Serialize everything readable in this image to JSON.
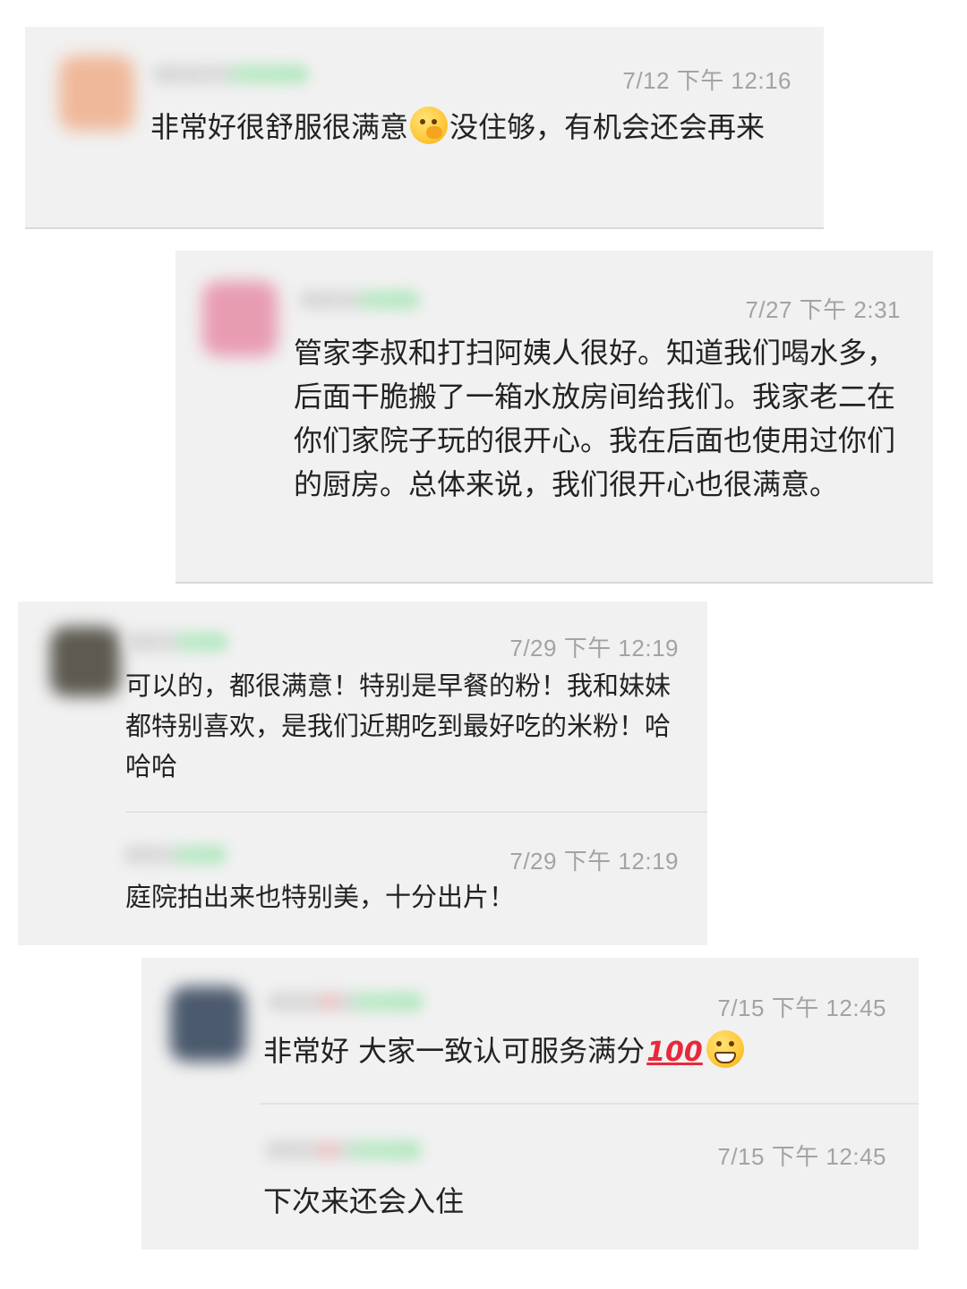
{
  "comments": [
    {
      "time": "7/12   下午 12:16",
      "text_before": "非常好很舒服很满意",
      "emoji": "hand-over-mouth-icon",
      "text_after": "没住够，有机会还会再来",
      "avatar_color": "#f0b89a"
    },
    {
      "time": "7/27   下午 2:31",
      "text": "管家李叔和打扫阿姨人很好。知道我们喝水多，后面干脆搬了一箱水放房间给我们。我家老二在你们家院子玩的很开心。我在后面也使用过你们的厨房。总体来说，我们很开心也很满意。",
      "avatar_color": "#e89cb2"
    },
    {
      "time": "7/29   下午 12:19",
      "text": "可以的，都很满意！特别是早餐的粉！我和妹妹都特别喜欢，是我们近期吃到最好吃的米粉！哈哈哈",
      "avatar_color": "#5e5a52"
    },
    {
      "time": "7/29   下午 12:19",
      "text": "庭院拍出来也特别美，十分出片！"
    },
    {
      "time": "7/15   下午 12:45",
      "text": "非常好 大家一致认可服务满分",
      "badge": "100",
      "emoji": "grinning-face-icon",
      "avatar_color": "#4c5a6e"
    },
    {
      "time": "7/15   下午 12:45",
      "text": "下次来还会入住"
    }
  ]
}
